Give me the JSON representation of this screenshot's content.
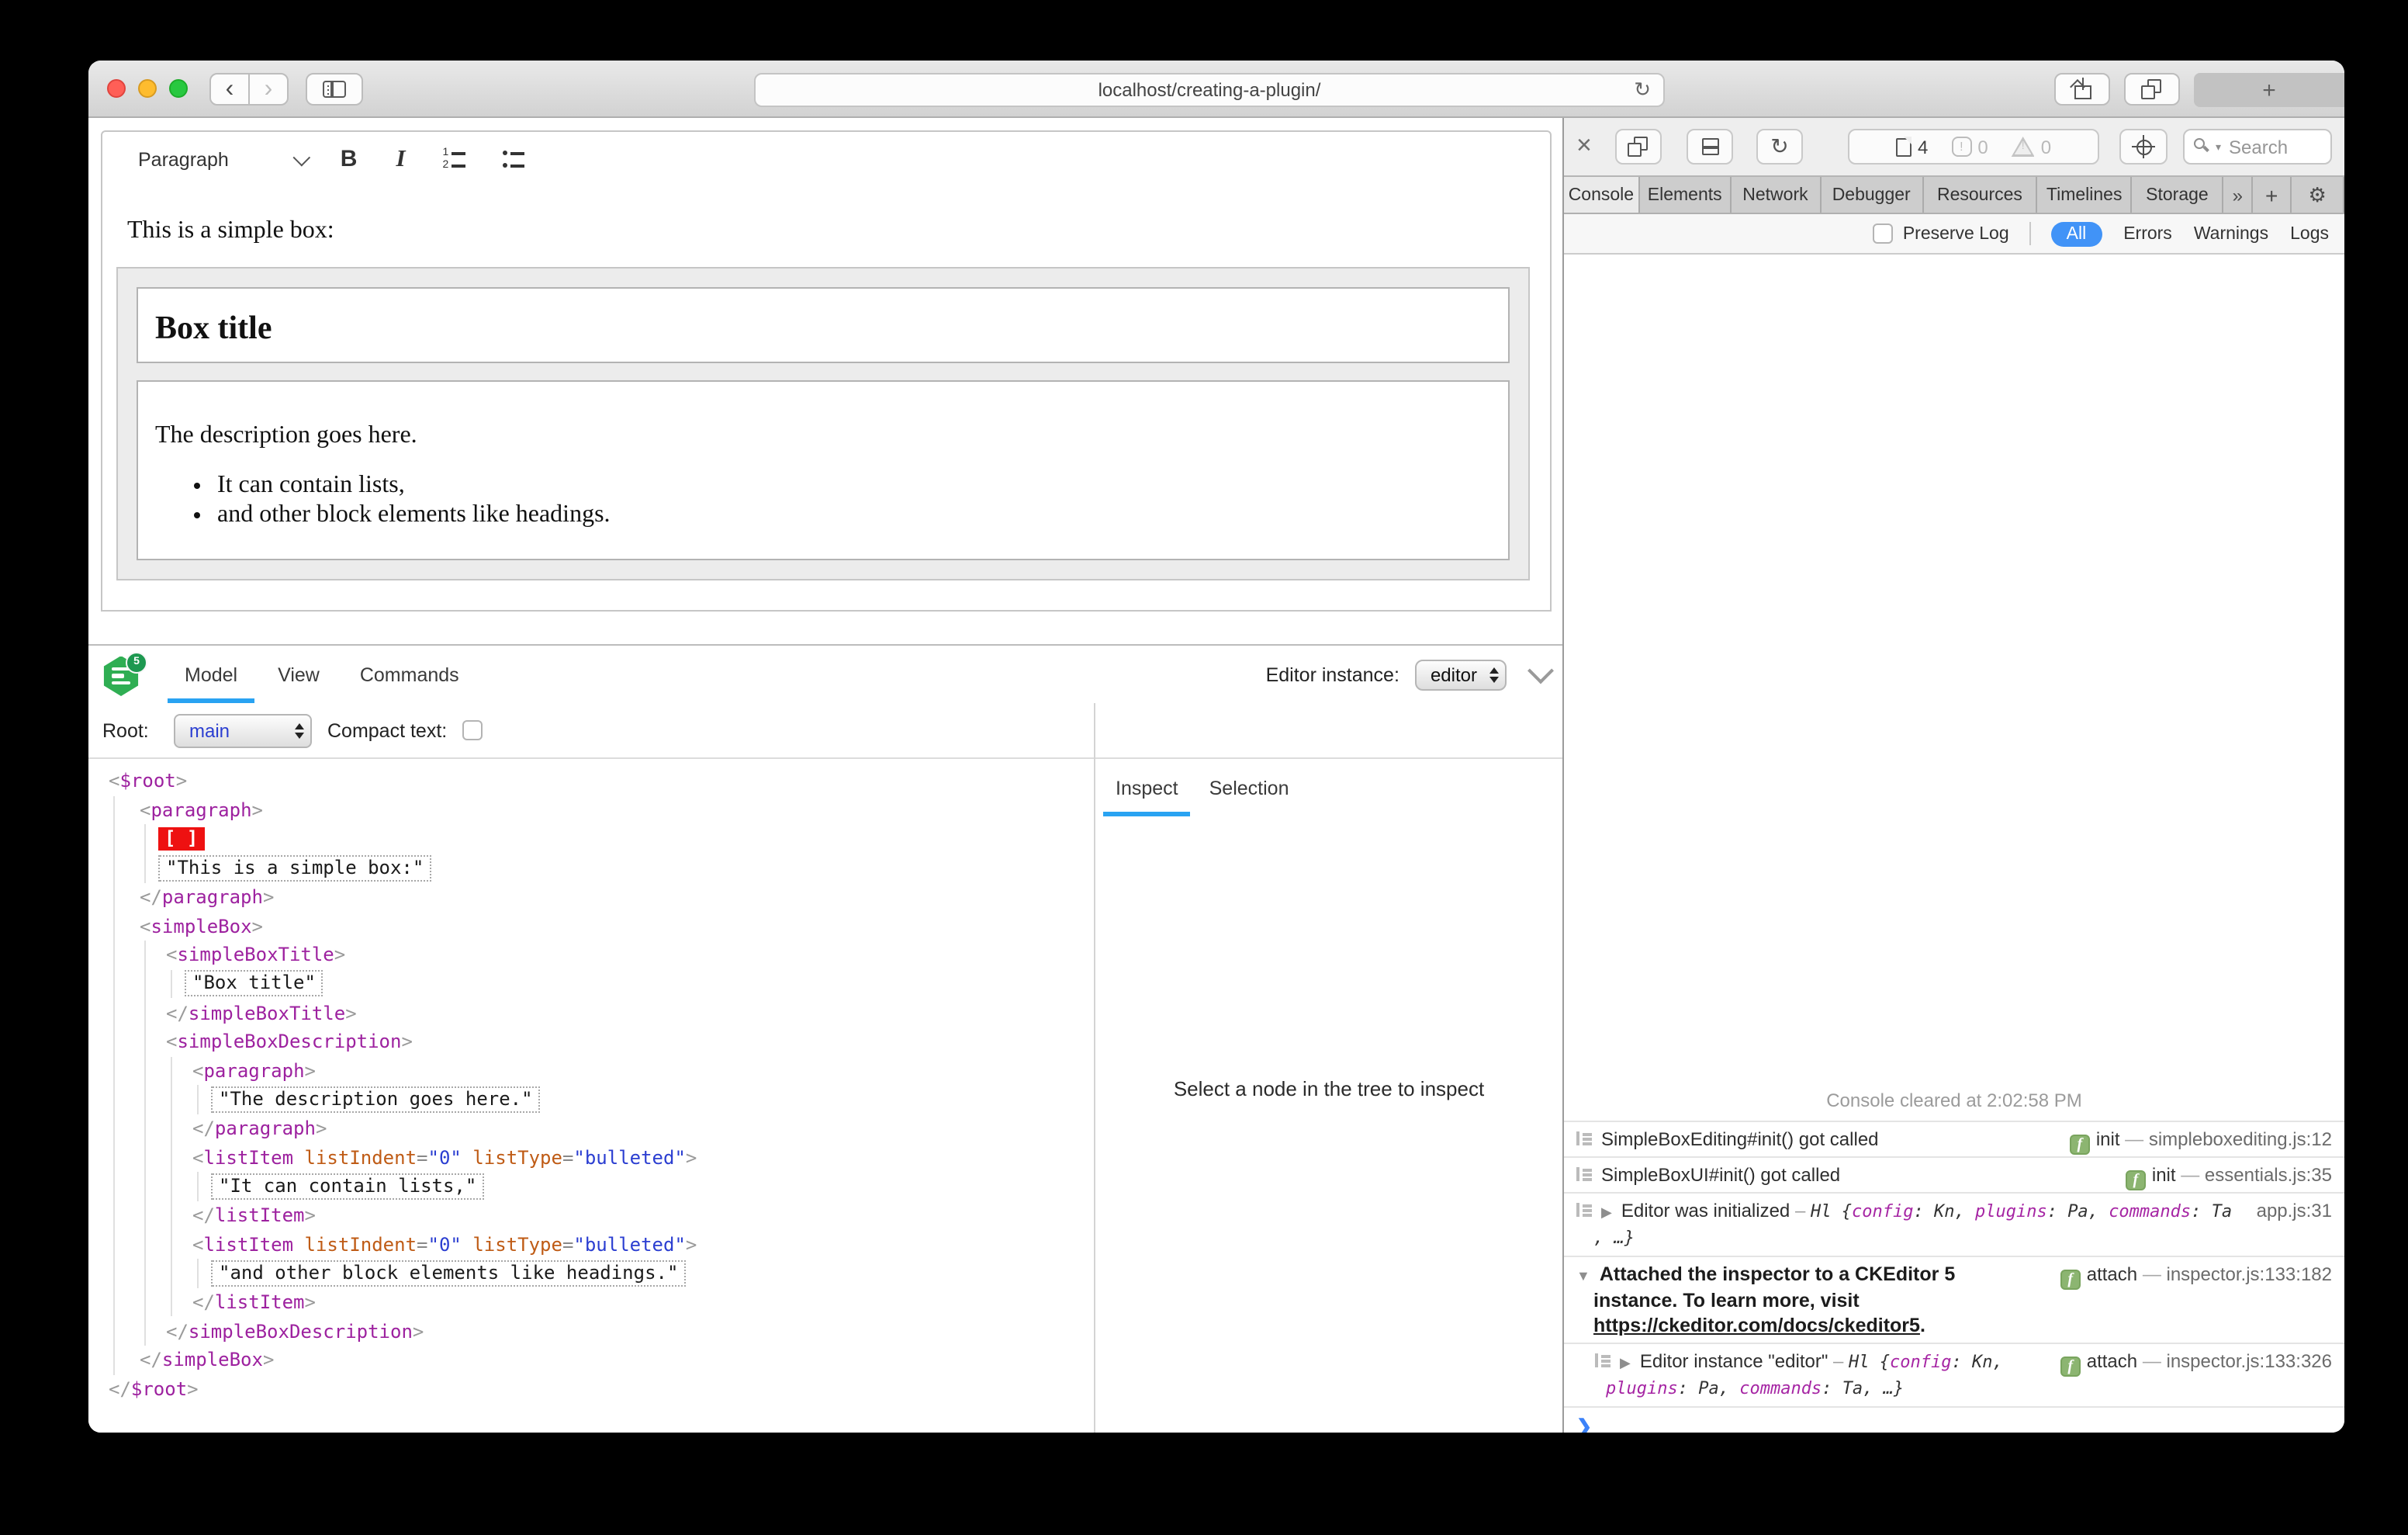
{
  "browser": {
    "url": "localhost/creating-a-plugin/"
  },
  "editor": {
    "toolbar": {
      "style_dropdown": "Paragraph",
      "bold": "B",
      "italic": "I"
    },
    "content": {
      "intro": "This is a simple box:",
      "box_title": "Box title",
      "description": "The description goes here.",
      "bullets": [
        "It can contain lists,",
        "and other block elements like headings."
      ]
    }
  },
  "inspector": {
    "logo_badge": "5",
    "tabs": [
      "Model",
      "View",
      "Commands"
    ],
    "active_tab": "Model",
    "instance_label": "Editor instance:",
    "instance_value": "editor",
    "root_label": "Root:",
    "root_value": "main",
    "compact_label": "Compact text:",
    "side_tabs": [
      "Inspect",
      "Selection"
    ],
    "active_side_tab": "Inspect",
    "empty_message": "Select a node in the tree to inspect",
    "tree": [
      {
        "lv": 0,
        "k": "open",
        "n": "$root"
      },
      {
        "lv": 1,
        "k": "open",
        "n": "paragraph"
      },
      {
        "lv": 2,
        "k": "marker",
        "t": "[ ]"
      },
      {
        "lv": 2,
        "k": "str",
        "t": "\"This is a simple box:\""
      },
      {
        "lv": 1,
        "k": "close",
        "n": "paragraph"
      },
      {
        "lv": 1,
        "k": "open",
        "n": "simpleBox"
      },
      {
        "lv": 2,
        "k": "open",
        "n": "simpleBoxTitle"
      },
      {
        "lv": 3,
        "k": "str",
        "t": "\"Box title\""
      },
      {
        "lv": 2,
        "k": "close",
        "n": "simpleBoxTitle"
      },
      {
        "lv": 2,
        "k": "open",
        "n": "simpleBoxDescription"
      },
      {
        "lv": 3,
        "k": "open",
        "n": "paragraph"
      },
      {
        "lv": 4,
        "k": "str",
        "t": "\"The description goes here.\""
      },
      {
        "lv": 3,
        "k": "close",
        "n": "paragraph"
      },
      {
        "lv": 3,
        "k": "open",
        "n": "listItem",
        "a": [
          [
            "listIndent",
            "0"
          ],
          [
            "listType",
            "bulleted"
          ]
        ]
      },
      {
        "lv": 4,
        "k": "str",
        "t": "\"It can contain lists,\""
      },
      {
        "lv": 3,
        "k": "close",
        "n": "listItem"
      },
      {
        "lv": 3,
        "k": "open",
        "n": "listItem",
        "a": [
          [
            "listIndent",
            "0"
          ],
          [
            "listType",
            "bulleted"
          ]
        ]
      },
      {
        "lv": 4,
        "k": "str",
        "t": "\"and other block elements like headings.\""
      },
      {
        "lv": 3,
        "k": "close",
        "n": "listItem"
      },
      {
        "lv": 2,
        "k": "close",
        "n": "simpleBoxDescription"
      },
      {
        "lv": 1,
        "k": "close",
        "n": "simpleBox"
      },
      {
        "lv": 0,
        "k": "close",
        "n": "$root"
      }
    ]
  },
  "devtools": {
    "counts": {
      "resources": "4",
      "errors": "0",
      "warnings": "0"
    },
    "search_placeholder": "Search",
    "tabs": [
      "Console",
      "Elements",
      "Network",
      "Debugger",
      "Resources",
      "Timelines",
      "Storage"
    ],
    "tab_widths": [
      49,
      59,
      58,
      66,
      74,
      61,
      59
    ],
    "active_tab": "Console",
    "overflow_icon": "»",
    "newtab_icon": "+",
    "gear_icon": "⚙",
    "preserve_label": "Preserve Log",
    "scopes": [
      "All",
      "Errors",
      "Warnings",
      "Logs"
    ],
    "active_scope": "All",
    "cleared": "Console cleared at 2:02:58 PM",
    "prompt": "❯",
    "rows": [
      {
        "icon": true,
        "lines": [
          {
            "pad": 0,
            "seg": [
              [
                "t",
                "SimpleBoxEditing#init() got called"
              ]
            ]
          }
        ],
        "badge": "init",
        "loc": "simpleboxediting.js:12"
      },
      {
        "icon": true,
        "lines": [
          {
            "pad": 0,
            "seg": [
              [
                "t",
                "SimpleBoxUI#init() got called"
              ]
            ]
          }
        ],
        "badge": "init",
        "loc": "essentials.js:35"
      },
      {
        "icon": true,
        "disc": "▶",
        "lines": [
          {
            "pad": 0,
            "seg": [
              [
                "t",
                "Editor was initialized"
              ],
              [
                "d",
                " – "
              ],
              [
                "m",
                "Hl "
              ],
              [
                "m",
                "{"
              ],
              [
                "k",
                "config"
              ],
              [
                "m",
                ": "
              ],
              [
                "v",
                "Kn"
              ],
              [
                "m",
                ", "
              ],
              [
                "k",
                "plugins"
              ],
              [
                "m",
                ": "
              ],
              [
                "v",
                "Pa"
              ],
              [
                "m",
                ", "
              ],
              [
                "k",
                "commands"
              ],
              [
                "m",
                ": "
              ],
              [
                "v",
                "Ta"
              ]
            ]
          },
          {
            "pad": 11,
            "seg": [
              [
                "m",
                ", …}"
              ]
            ]
          }
        ],
        "loc": "app.js:31"
      },
      {
        "disc": "▼",
        "lines": [
          {
            "pad": 0,
            "seg": [
              [
                "b",
                "Attached the inspector to a CKEditor 5"
              ]
            ]
          },
          {
            "pad": 11,
            "seg": [
              [
                "b",
                "instance. To learn more, visit"
              ]
            ]
          },
          {
            "pad": 11,
            "seg": [
              [
                "a",
                "https://ckeditor.com/docs/ckeditor5"
              ],
              [
                "b",
                "."
              ]
            ]
          }
        ],
        "badge": "attach",
        "loc": "inspector.js:133:182"
      },
      {
        "icon": true,
        "disc": "▶",
        "indent": 12,
        "lines": [
          {
            "pad": 0,
            "seg": [
              [
                "t",
                "Editor instance \"editor\""
              ],
              [
                "d",
                " – "
              ],
              [
                "m",
                "Hl "
              ],
              [
                "m",
                "{"
              ],
              [
                "k",
                "config"
              ],
              [
                "m",
                ": "
              ],
              [
                "v",
                "Kn"
              ],
              [
                "m",
                ","
              ]
            ]
          },
          {
            "pad": 7,
            "seg": [
              [
                "k",
                "plugins"
              ],
              [
                "m",
                ": "
              ],
              [
                "v",
                "Pa"
              ],
              [
                "m",
                ", "
              ],
              [
                "k",
                "commands"
              ],
              [
                "m",
                ": "
              ],
              [
                "v",
                "Ta"
              ],
              [
                "m",
                ", …}"
              ]
            ]
          }
        ],
        "badge": "attach",
        "loc": "inspector.js:133:326"
      }
    ]
  },
  "colors": {
    "accent_blue": "#29a3f2",
    "filter_blue": "#4193f7",
    "selection_red": "#ee1111",
    "tag_purple": "#9d219f",
    "attr_orange": "#bf5b15",
    "value_blue": "#2b3ed1",
    "badge_green": "#8cb571",
    "logo_green": "#2fae53"
  }
}
